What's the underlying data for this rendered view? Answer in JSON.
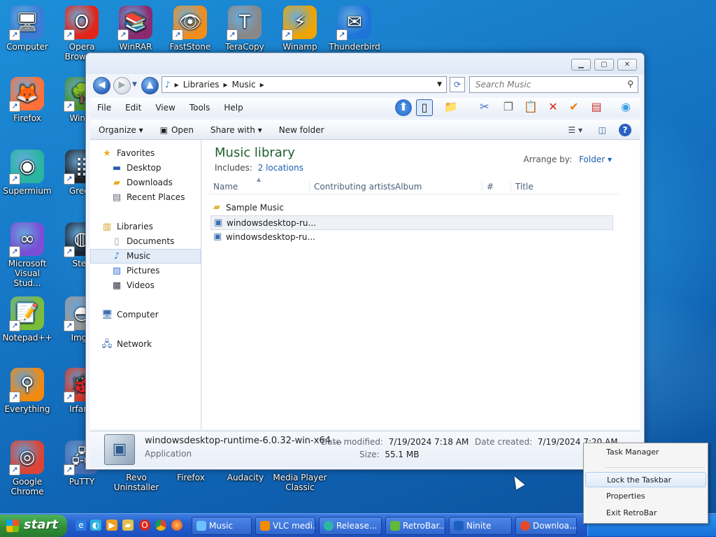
{
  "desktop": {
    "icons": [
      {
        "label": "Computer",
        "glyph": "🖥",
        "color": "#3a7bd5"
      },
      {
        "label": "Opera Browser",
        "glyph": "O",
        "color": "#e1251b"
      },
      {
        "label": "WinRAR",
        "glyph": "📚",
        "color": "#8b2a6e"
      },
      {
        "label": "FastStone",
        "glyph": "👁",
        "color": "#f28c1b"
      },
      {
        "label": "TeraCopy",
        "glyph": "T",
        "color": "#888888"
      },
      {
        "label": "Winamp",
        "glyph": "⚡",
        "color": "#f0a400"
      },
      {
        "label": "Thunderbird",
        "glyph": "✉",
        "color": "#1f74d8"
      },
      {
        "label": "Firefox",
        "glyph": "🦊",
        "color": "#ff7139"
      },
      {
        "label": "WinDi",
        "glyph": "🌳",
        "color": "#4a8f2c"
      },
      {
        "label": "Supermium",
        "glyph": "◉",
        "color": "#2ab5a0"
      },
      {
        "label": "Green",
        "glyph": "⣿",
        "color": "#222222"
      },
      {
        "label": "Microsoft Visual Stud...",
        "glyph": "∞",
        "color": "#7a4fd6"
      },
      {
        "label": "Stea",
        "glyph": "◍",
        "color": "#1b2838"
      },
      {
        "label": "Notepad++",
        "glyph": "📝",
        "color": "#7bbd3a"
      },
      {
        "label": "ImgB",
        "glyph": "◓",
        "color": "#9a9a9a"
      },
      {
        "label": "Everything",
        "glyph": "⚲",
        "color": "#f28a10"
      },
      {
        "label": "IrfanV",
        "glyph": "🐞",
        "color": "#d23a2a"
      },
      {
        "label": "Google Chrome",
        "glyph": "◎",
        "color": "#db4437"
      },
      {
        "label": "PuTTY",
        "glyph": "🖧",
        "color": "#4a6fb5"
      },
      {
        "label": "Revo Uninstaller",
        "glyph": "",
        "color": "#1f5fa8"
      },
      {
        "label": "Firefox",
        "glyph": "",
        "color": "#ff7139"
      },
      {
        "label": "Audacity",
        "glyph": "",
        "color": "#f26522"
      },
      {
        "label": "Media Player Classic",
        "glyph": "",
        "color": "#333333"
      }
    ]
  },
  "explorer": {
    "window_buttons": {
      "minimize": "▁",
      "maximize": "▢",
      "close": "✕"
    },
    "address": {
      "crumbs": [
        "Libraries",
        "Music"
      ],
      "separator": "▸"
    },
    "search": {
      "placeholder": "Search Music"
    },
    "menu": [
      "File",
      "Edit",
      "View",
      "Tools",
      "Help"
    ],
    "commands": {
      "organize": "Organize ▾",
      "open": "Open",
      "share": "Share with ▾",
      "new_folder": "New folder"
    },
    "nav": {
      "favorites": "Favorites",
      "desktop": "Desktop",
      "downloads": "Downloads",
      "recent": "Recent Places",
      "libraries": "Libraries",
      "documents": "Documents",
      "music": "Music",
      "pictures": "Pictures",
      "videos": "Videos",
      "computer": "Computer",
      "network": "Network"
    },
    "library": {
      "title": "Music library",
      "includes_prefix": "Includes:",
      "includes_link": "2 locations",
      "arrange_label": "Arrange by:",
      "arrange_value": "Folder ▾"
    },
    "columns": [
      "Name",
      "Contributing artists",
      "Album",
      "#",
      "Title"
    ],
    "files": [
      {
        "name": "Sample Music",
        "type": "folder"
      },
      {
        "name": "windowsdesktop-ru...",
        "type": "app"
      },
      {
        "name": "windowsdesktop-ru...",
        "type": "app"
      }
    ],
    "details": {
      "name": "windowsdesktop-runtime-6.0.32-win-x64 ...",
      "type": "Application",
      "modified_label": "Date modified:",
      "modified_value": "7/19/2024 7:18 AM",
      "size_label": "Size:",
      "size_value": "55.1 MB",
      "created_label": "Date created:",
      "created_value": "7/19/2024 7:20 AM"
    }
  },
  "taskbar": {
    "start_label": "start",
    "buttons": [
      {
        "label": "Music",
        "color": "#6ec1ff"
      },
      {
        "label": "VLC medi...",
        "color": "#f48b00"
      },
      {
        "label": "Release...",
        "color": "#2db7a3"
      },
      {
        "label": "RetroBar...",
        "color": "#63b83a"
      },
      {
        "label": "Ninite",
        "color": "#1d5fbf"
      },
      {
        "label": "Downloa...",
        "color": "#e24a2a"
      }
    ]
  },
  "context_menu": {
    "items": [
      "Task Manager",
      "Lock the Taskbar",
      "Properties",
      "Exit RetroBar"
    ]
  }
}
